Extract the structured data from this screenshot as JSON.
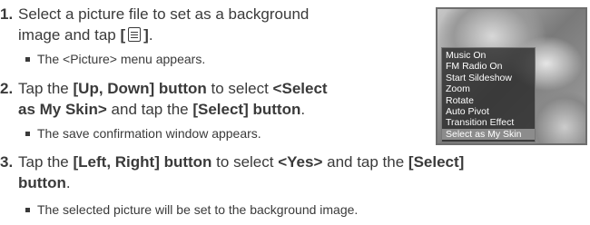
{
  "steps": [
    {
      "num": "1.",
      "line1": "Select a picture file to set as a background",
      "line2": "image and tap ",
      "bracket_open": "[",
      "bracket_close": "]",
      "line2_end": ".",
      "bullet": "The <Picture> menu appears."
    },
    {
      "num": "2.",
      "p1": "Tap the ",
      "b1": "[Up, Down] button",
      "p2": " to select ",
      "b2": "<Select",
      "b3": "as My Skin>",
      "p3": " and tap the ",
      "b4": "[Select] button",
      "p4": ".",
      "bullet": "The save confirmation window appears."
    },
    {
      "num": "3.",
      "p1": "Tap the ",
      "b1": "[Left, Right] button",
      "p2": " to select ",
      "b2": "<Yes>",
      "p3": " and tap the ",
      "b3": "[Select]",
      "b4": "button",
      "p4": ".",
      "bullet": "The selected picture will be set to the background image."
    }
  ],
  "icons": {
    "menu_icon": "menu-icon"
  },
  "device_menu": {
    "items": [
      "Music On",
      "FM Radio On",
      "Start Sildeshow",
      "Zoom",
      "Rotate",
      "Auto Pivot",
      "Transition Effect",
      "Select as My Skin"
    ],
    "selected_index": 7
  }
}
